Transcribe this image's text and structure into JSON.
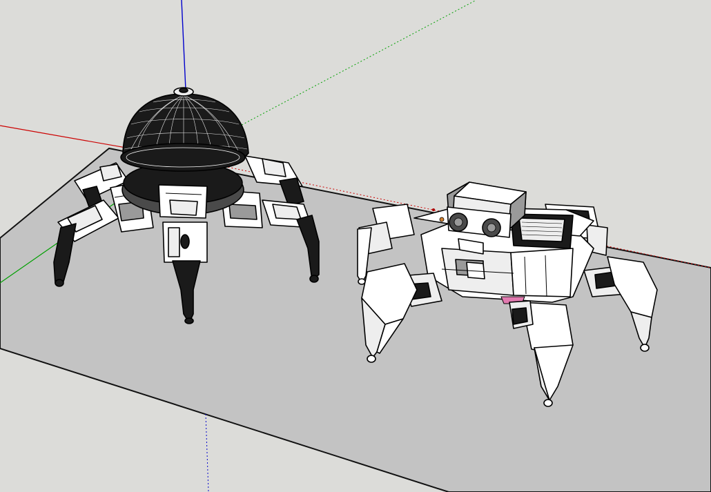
{
  "app": "SketchUp",
  "view": {
    "background": "#dcdcd9",
    "ground_color": "#c2c2c2",
    "axis_colors": {
      "red": "#cc0000",
      "green": "#00a000",
      "blue": "#0000cc"
    }
  },
  "models": [
    {
      "name": "dome-hexapod-robot",
      "style": "dark wireframe dome body with six legs"
    },
    {
      "name": "box-hexapod-robot",
      "style": "white faceted body with sensor head and six legs"
    }
  ]
}
